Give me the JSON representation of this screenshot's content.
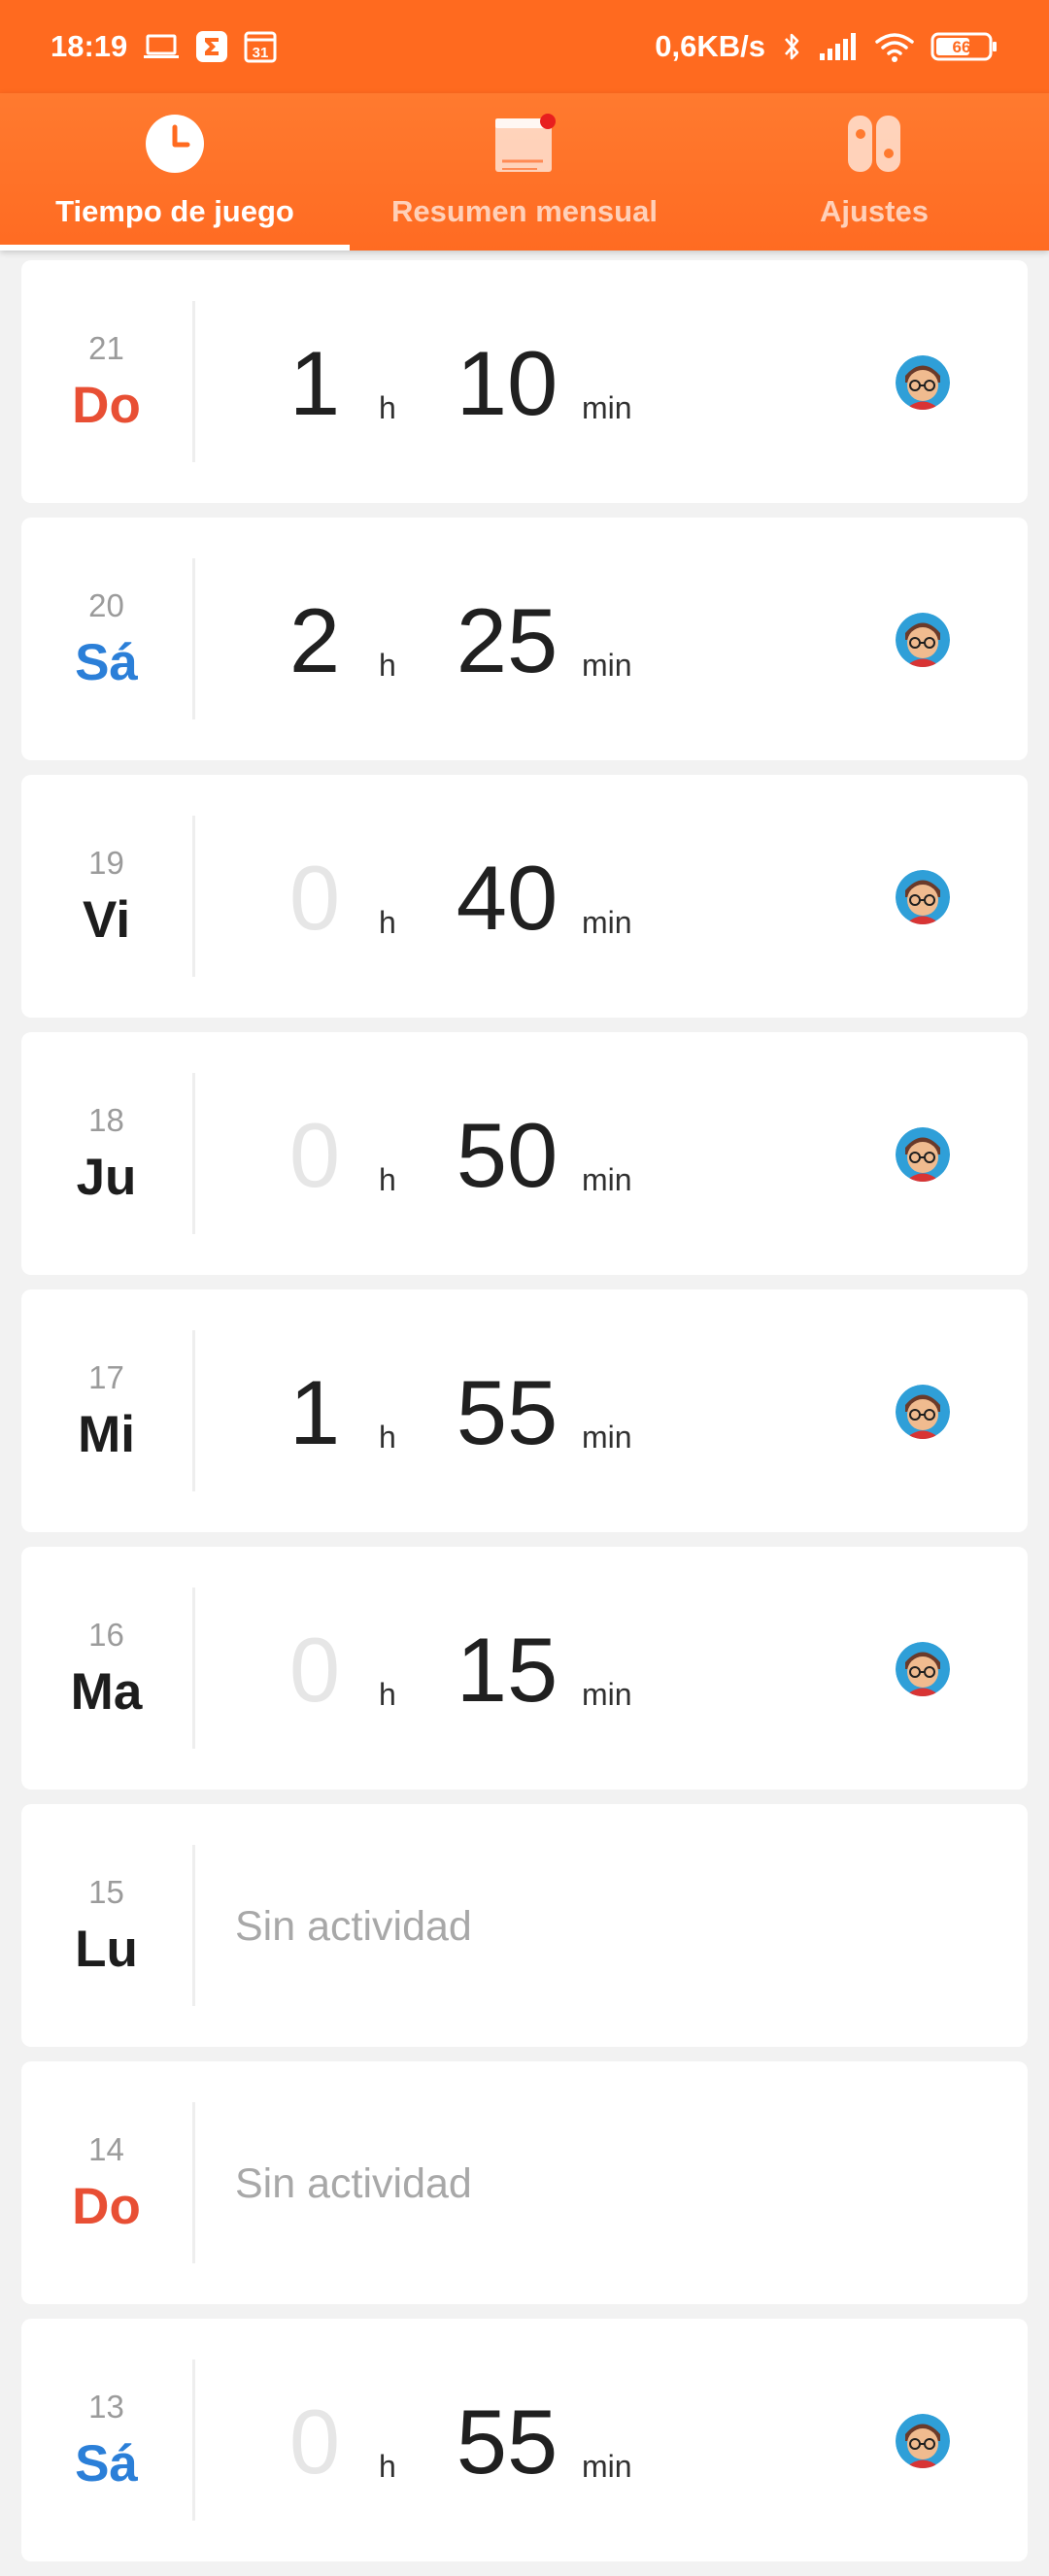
{
  "status_bar": {
    "time": "18:19",
    "network_speed": "0,6KB/s",
    "battery": "66",
    "calendar_day": "31",
    "left_icons": [
      "laptop-icon",
      "sigma-app-icon",
      "calendar-icon"
    ],
    "right_icons": [
      "bluetooth-icon",
      "signal-icon",
      "wifi-icon",
      "battery-icon"
    ]
  },
  "tabs": [
    {
      "label": "Tiempo de juego",
      "icon": "clock-icon",
      "active": true
    },
    {
      "label": "Resumen mensual",
      "icon": "calendar-notification-icon",
      "active": false
    },
    {
      "label": "Ajustes",
      "icon": "switch-console-icon",
      "active": false
    }
  ],
  "colors": {
    "accent": "#ff6a1f",
    "sunday": "#e84f34",
    "saturday": "#2b7fd8",
    "zero_hours": "#e6e6e6",
    "notification_dot": "#e81e1e"
  },
  "units": {
    "hours": "h",
    "minutes": "min"
  },
  "days": [
    {
      "date": "21",
      "weekday": "Do",
      "kind": "sunday",
      "hours": "1",
      "minutes": "10",
      "activity": true
    },
    {
      "date": "20",
      "weekday": "Sá",
      "kind": "saturday",
      "hours": "2",
      "minutes": "25",
      "activity": true
    },
    {
      "date": "19",
      "weekday": "Vi",
      "kind": "weekday",
      "hours": "0",
      "minutes": "40",
      "activity": true
    },
    {
      "date": "18",
      "weekday": "Ju",
      "kind": "weekday",
      "hours": "0",
      "minutes": "50",
      "activity": true
    },
    {
      "date": "17",
      "weekday": "Mi",
      "kind": "weekday",
      "hours": "1",
      "minutes": "55",
      "activity": true
    },
    {
      "date": "16",
      "weekday": "Ma",
      "kind": "weekday",
      "hours": "0",
      "minutes": "15",
      "activity": true
    },
    {
      "date": "15",
      "weekday": "Lu",
      "kind": "weekday",
      "activity": false,
      "message": "Sin actividad"
    },
    {
      "date": "14",
      "weekday": "Do",
      "kind": "sunday",
      "activity": false,
      "message": "Sin actividad"
    },
    {
      "date": "13",
      "weekday": "Sá",
      "kind": "saturday",
      "hours": "0",
      "minutes": "55",
      "activity": true
    }
  ]
}
